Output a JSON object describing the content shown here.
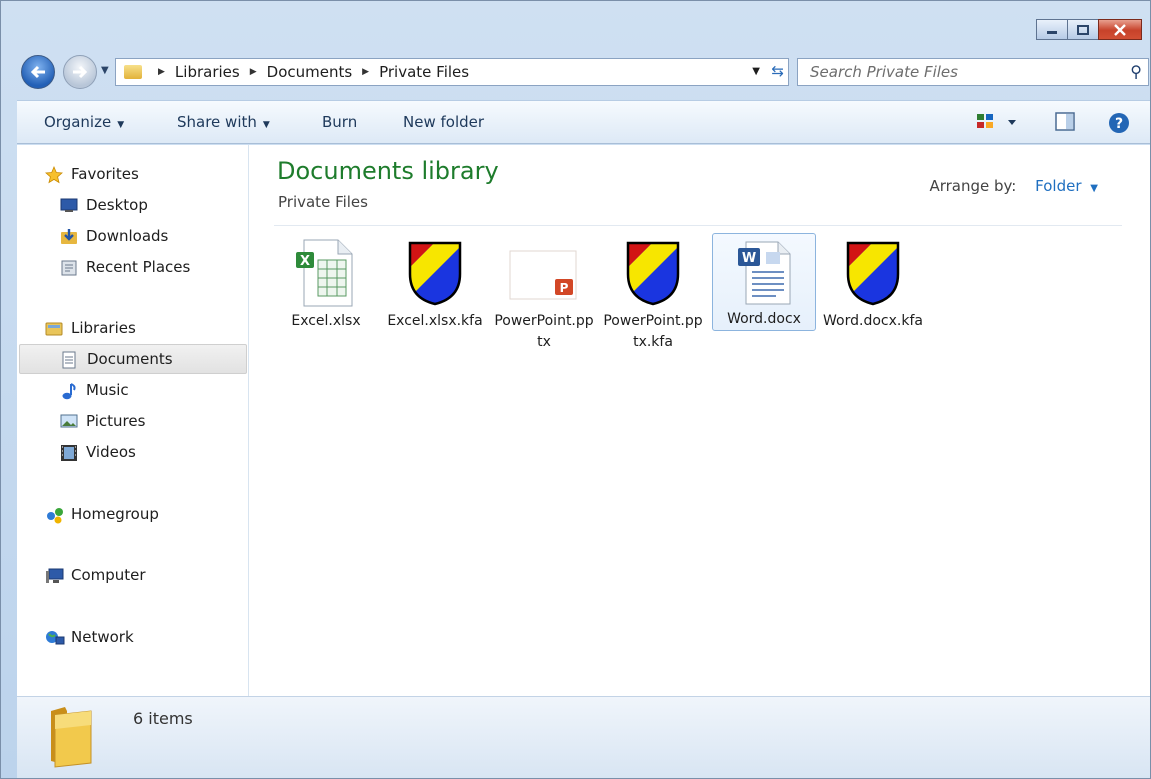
{
  "window": {
    "minimize_label": "–",
    "maximize_label": "□",
    "close_label": "✕"
  },
  "address": {
    "crumbs": [
      "Libraries",
      "Documents",
      "Private Files"
    ]
  },
  "search": {
    "placeholder": "Search Private Files"
  },
  "toolbar": {
    "organize": "Organize",
    "share_with": "Share with",
    "burn": "Burn",
    "new_folder": "New folder"
  },
  "nav": {
    "favorites": "Favorites",
    "desktop": "Desktop",
    "downloads": "Downloads",
    "recent_places": "Recent Places",
    "libraries": "Libraries",
    "documents": "Documents",
    "music": "Music",
    "pictures": "Pictures",
    "videos": "Videos",
    "homegroup": "Homegroup",
    "computer": "Computer",
    "network": "Network"
  },
  "content": {
    "title": "Documents library",
    "subtitle": "Private Files",
    "arrange_label": "Arrange by:",
    "arrange_value": "Folder"
  },
  "files": [
    {
      "name": "Excel.xlsx",
      "icon": "excel-icon"
    },
    {
      "name": "Excel.xlsx.kfa",
      "icon": "shield-icon"
    },
    {
      "name": "PowerPoint.pptx",
      "icon": "powerpoint-icon"
    },
    {
      "name": "PowerPoint.pptx.kfa",
      "icon": "shield-icon"
    },
    {
      "name": "Word.docx",
      "icon": "word-icon"
    },
    {
      "name": "Word.docx.kfa",
      "icon": "shield-icon"
    }
  ],
  "status": {
    "count": "6 items"
  },
  "colors": {
    "title_green": "#1e7c2c",
    "link_blue": "#1f6fc0"
  }
}
